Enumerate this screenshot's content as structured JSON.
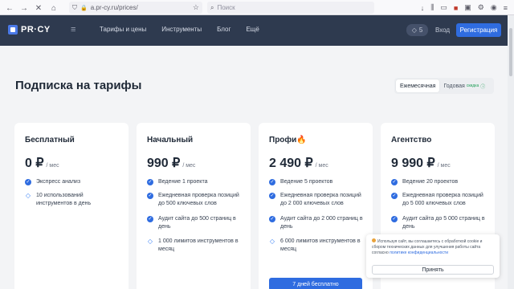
{
  "browser": {
    "url": "a.pr-cy.ru/prices/",
    "search_placeholder": "Поиск"
  },
  "header": {
    "logo": "PR·CY",
    "nav": [
      "Тарифы и цены",
      "Инструменты",
      "Блог",
      "Ещё"
    ],
    "badge_count": "5",
    "login": "Вход",
    "register": "Регистрация"
  },
  "page": {
    "title": "Подписка на тарифы",
    "period": {
      "monthly": "Ежемесячная",
      "yearly": "Годовая",
      "yearly_note": "скидка"
    }
  },
  "plans": [
    {
      "name": "Бесплатный",
      "price": "0 ₽",
      "per": "/ мес",
      "features": [
        {
          "icon": "check-icon",
          "text": "Экспресс анализ"
        },
        {
          "icon": "gem-icon",
          "text": "10 использований инструментов в день"
        }
      ]
    },
    {
      "name": "Начальный",
      "price": "990 ₽",
      "per": "/ мес",
      "features": [
        {
          "icon": "check-icon",
          "text": "Ведение 1 проекта"
        },
        {
          "icon": "check-icon",
          "text": "Ежедневная проверка позиций до 500 ключевых слов"
        },
        {
          "icon": "check-icon",
          "text": "Аудит сайта до 500 страниц в день"
        },
        {
          "icon": "gem-icon",
          "text": "1 000 лимитов инструментов в месяц"
        }
      ]
    },
    {
      "name": "Профи",
      "name_emoji": "🔥",
      "price": "2 490 ₽",
      "per": "/ мес",
      "features": [
        {
          "icon": "check-icon",
          "text": "Ведение 5 проектов"
        },
        {
          "icon": "check-icon",
          "text": "Ежедневная проверка позиций до 2 000 ключевых слов"
        },
        {
          "icon": "check-icon",
          "text": "Аудит сайта до 2 000 страниц в день"
        },
        {
          "icon": "gem-icon",
          "text": "6 000 лимитов инструментов в месяц"
        }
      ],
      "trial_button": "7 дней бесплатно"
    },
    {
      "name": "Агентство",
      "price": "9 990 ₽",
      "per": "/ мес",
      "features": [
        {
          "icon": "check-icon",
          "text": "Ведение 20 проектов"
        },
        {
          "icon": "check-icon",
          "text": "Ежедневная проверка позиций до 5 000 ключевых слов"
        },
        {
          "icon": "check-icon",
          "text": "Аудит сайта до 5 000 страниц в день"
        }
      ]
    }
  ],
  "cookie": {
    "text": "Используя сайт, вы соглашаетесь с обработкой cookie и сбором технических данных для улучшения работы сайта согласно",
    "link": "политике конфиденциальности",
    "accept": "Принять"
  }
}
